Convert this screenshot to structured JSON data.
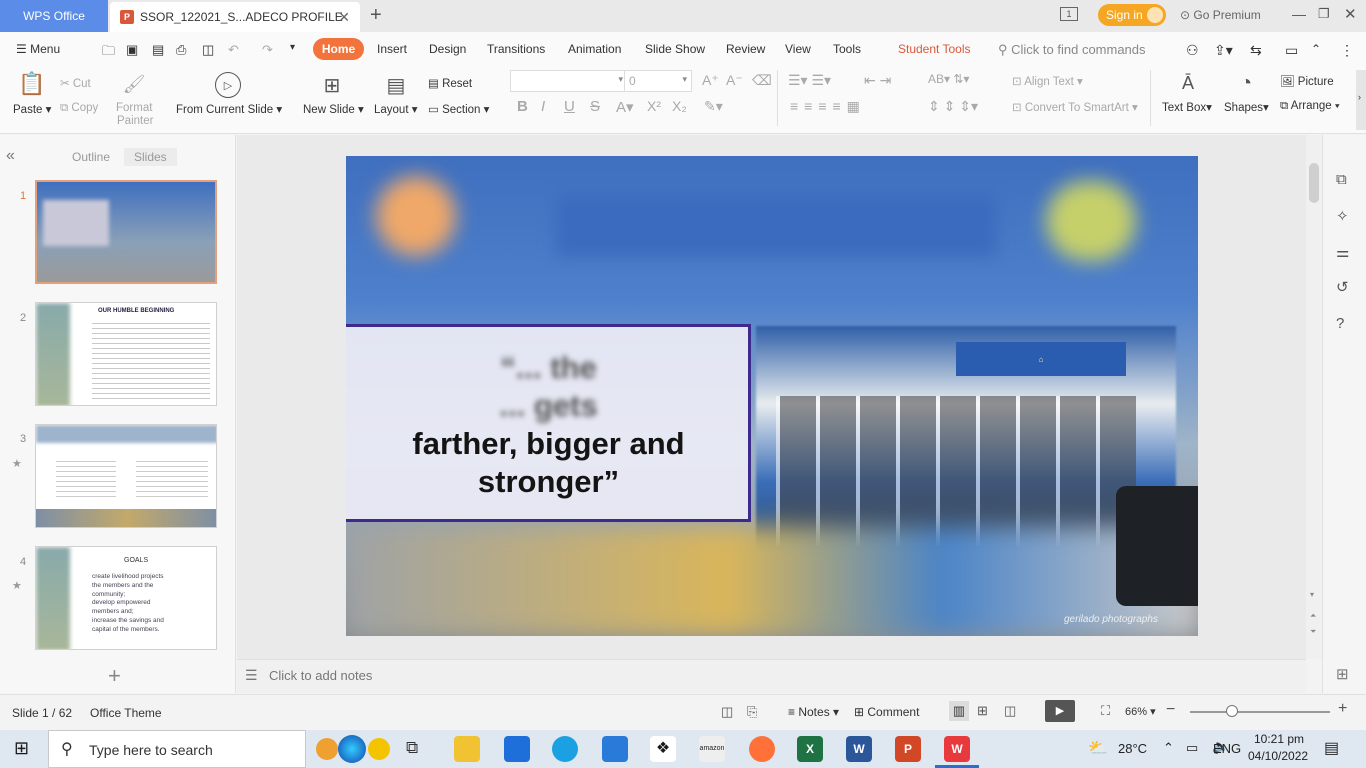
{
  "titlebar": {
    "app_tab": "WPS Office",
    "doc_tab": "SSOR_122021_S...ADECO PROFILE",
    "signin": "Sign in",
    "premium": "Go Premium"
  },
  "menu": {
    "menu_label": "Menu",
    "tabs": [
      "Home",
      "Insert",
      "Design",
      "Transitions",
      "Animation",
      "Slide Show",
      "Review",
      "View",
      "Tools",
      "Student Tools"
    ],
    "search_placeholder": "Click to find commands"
  },
  "ribbon": {
    "paste": "Paste",
    "cut": "Cut",
    "copy": "Copy",
    "format_painter_1": "Format",
    "format_painter_2": "Painter",
    "from_current": "From Current Slide",
    "new_slide": "New Slide",
    "layout": "Layout",
    "reset": "Reset",
    "section": "Section",
    "font_size": "0",
    "align_text": "Align Text",
    "convert_smartart": "Convert To SmartArt",
    "text_box": "Text Box",
    "shapes": "Shapes",
    "picture": "Picture",
    "arrange": "Arrange"
  },
  "panel": {
    "tab_outline": "Outline",
    "tab_slides": "Slides",
    "thumb2_title": "OUR HUMBLE BEGINNING",
    "thumb4_title": "GOALS",
    "thumb4_lines": [
      "create livelihood projects",
      "the members and the",
      "community;",
      "develop empowered",
      "members and;",
      "increase the savings and",
      "capital of the members."
    ]
  },
  "slide": {
    "quote_line1": "“... the",
    "quote_line2": "... gets",
    "quote_line3": "farther, bigger and",
    "quote_line4": "stronger”",
    "watermark": "gerilado photographs"
  },
  "notes": {
    "placeholder": "Click to add notes"
  },
  "status": {
    "slide_count": "Slide 1 / 62",
    "theme": "Office Theme",
    "notes": "Notes",
    "comment": "Comment",
    "zoom": "66%"
  },
  "taskbar": {
    "search": "Type here to search",
    "weather": "28°C",
    "lang": "ENG",
    "time": "10:21 pm",
    "date": "04/10/2022"
  },
  "colors": {
    "accent": "#f2733c",
    "wps_blue": "#5b8ce8"
  }
}
